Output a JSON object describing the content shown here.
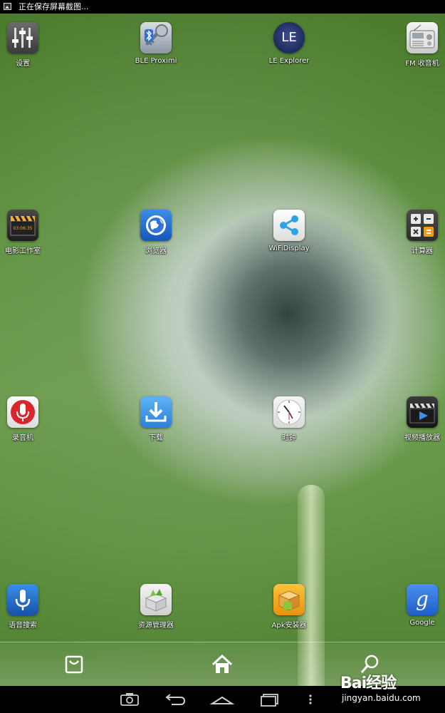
{
  "status_bar": {
    "notification_icon": "image-icon",
    "text": "正在保存屏幕截图..."
  },
  "apps": [
    {
      "label": "设置",
      "icon": "settings-sliders-icon"
    },
    {
      "label": "BLE Proximi",
      "icon": "bluetooth-keys-icon"
    },
    {
      "label": "LE Explorer",
      "icon": "le-badge-icon",
      "icon_text": "LE"
    },
    {
      "label": "FM 收音机",
      "icon": "radio-icon"
    },
    {
      "label": "电影工作室",
      "icon": "clapperboard-icon",
      "icon_text": "03:06:35"
    },
    {
      "label": "浏览器",
      "icon": "globe-icon"
    },
    {
      "label": "WiFiDisplay",
      "icon": "share-icon"
    },
    {
      "label": "计算器",
      "icon": "calculator-icon"
    },
    {
      "label": "录音机",
      "icon": "microphone-icon"
    },
    {
      "label": "下载",
      "icon": "download-icon"
    },
    {
      "label": "时钟",
      "icon": "clock-icon"
    },
    {
      "label": "视频播放器",
      "icon": "video-player-icon"
    },
    {
      "label": "语音搜索",
      "icon": "voice-search-icon"
    },
    {
      "label": "资源管理器",
      "icon": "file-manager-icon"
    },
    {
      "label": "Apk安装器",
      "icon": "android-box-icon"
    },
    {
      "label": "Google",
      "icon": "google-g-icon",
      "icon_text": "g"
    }
  ],
  "dock": {
    "items": [
      "shopping-bag-icon",
      "home-icon",
      "search-icon"
    ]
  },
  "nav_bar": {
    "items": [
      "screenshot-camera-icon",
      "back-icon",
      "home-outline-icon",
      "recent-apps-icon",
      "menu-dots-icon"
    ]
  },
  "watermark": {
    "brand": "Bai经验",
    "url": "jingyan.baidu.com"
  },
  "colors": {
    "status_bar": "#000000",
    "wallpaper_green": "#5b8f3c",
    "label_text": "#ffffff"
  }
}
